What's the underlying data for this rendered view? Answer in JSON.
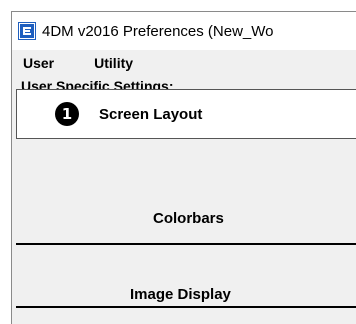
{
  "window": {
    "title": "4DM v2016 Preferences (New_Wo"
  },
  "menu": {
    "items": [
      "User",
      "Utility"
    ]
  },
  "section": {
    "label": "User Specific Settings:"
  },
  "tabs": [
    {
      "label": "Screen Layout",
      "selected": true,
      "badge": "1"
    },
    {
      "label": "Colorbars",
      "selected": false
    },
    {
      "label": "Image Display",
      "selected": false
    }
  ],
  "colors": {
    "window_bg": "#f0f0f0",
    "selected_bg": "#ffffff",
    "icon_blue": "#1f5fbf"
  }
}
